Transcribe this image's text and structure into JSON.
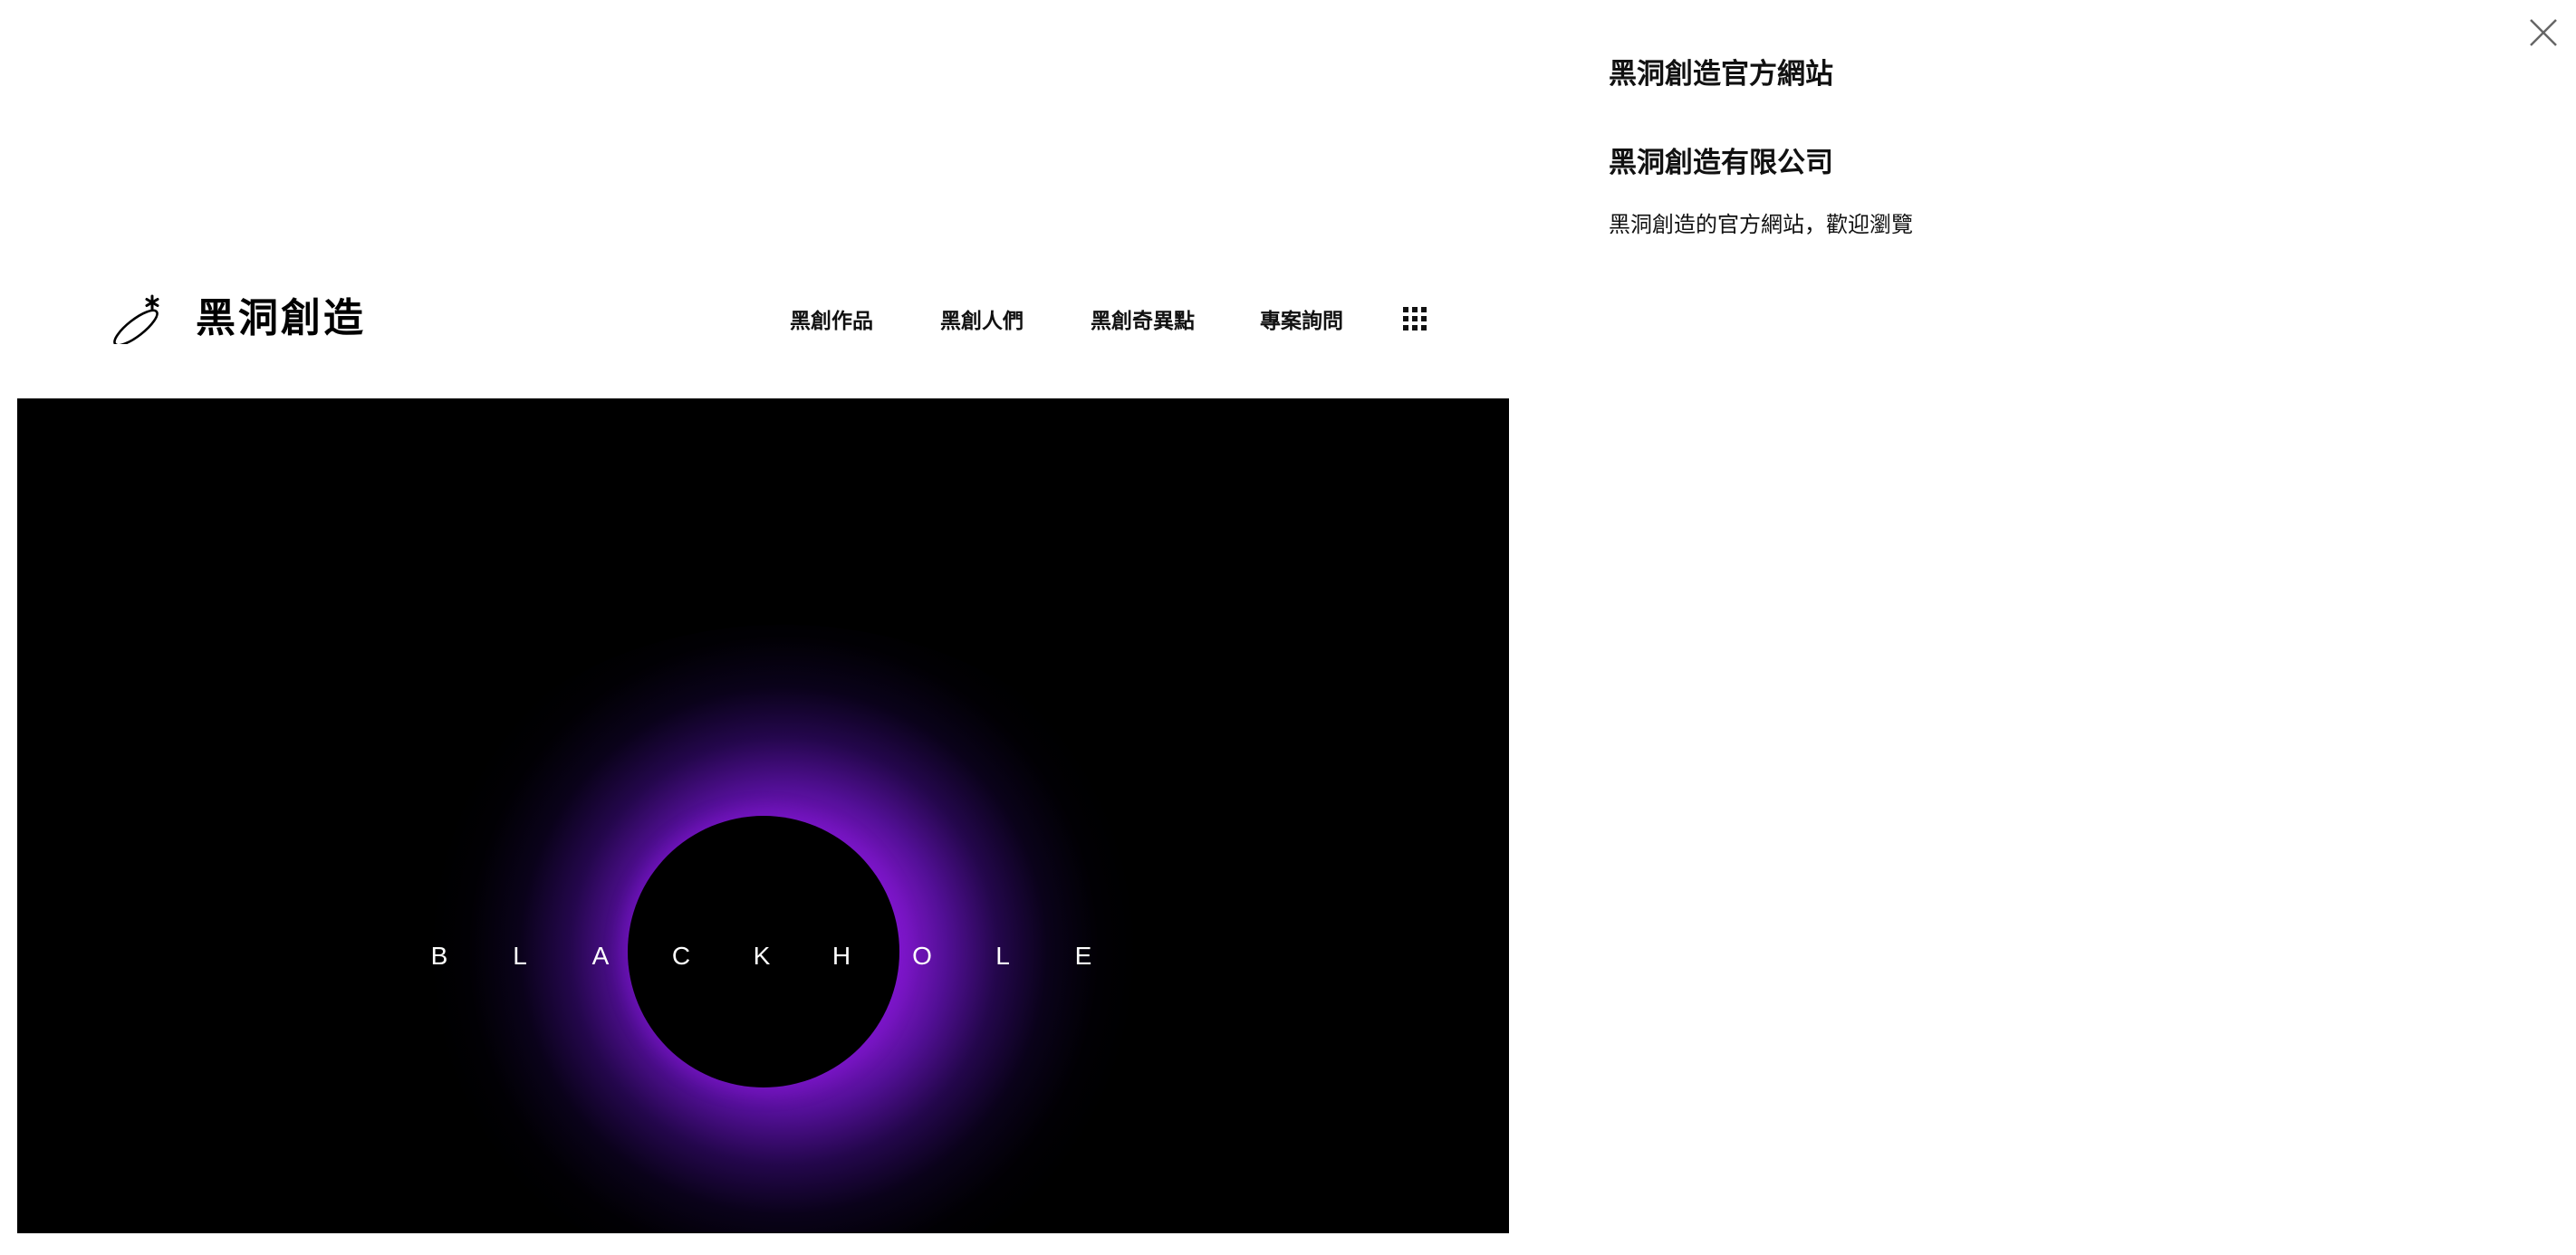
{
  "site": {
    "logo_text": "黑洞創造",
    "nav": [
      {
        "label": "黑創作品"
      },
      {
        "label": "黑創人們"
      },
      {
        "label": "黑創奇異點"
      },
      {
        "label": "專案詢問"
      }
    ],
    "menu_icon": "grid-menu-icon"
  },
  "hero": {
    "letters": [
      "B",
      "L",
      "A",
      "C",
      "K",
      "H",
      "O",
      "L",
      "E"
    ],
    "background_color": "#000000",
    "glow_color": "#9b1ee6"
  },
  "panel": {
    "title": "黑洞創造官方網站",
    "company": "黑洞創造有限公司",
    "description": "黑洞創造的官方網站，歡迎瀏覽",
    "close_icon": "close-icon"
  }
}
